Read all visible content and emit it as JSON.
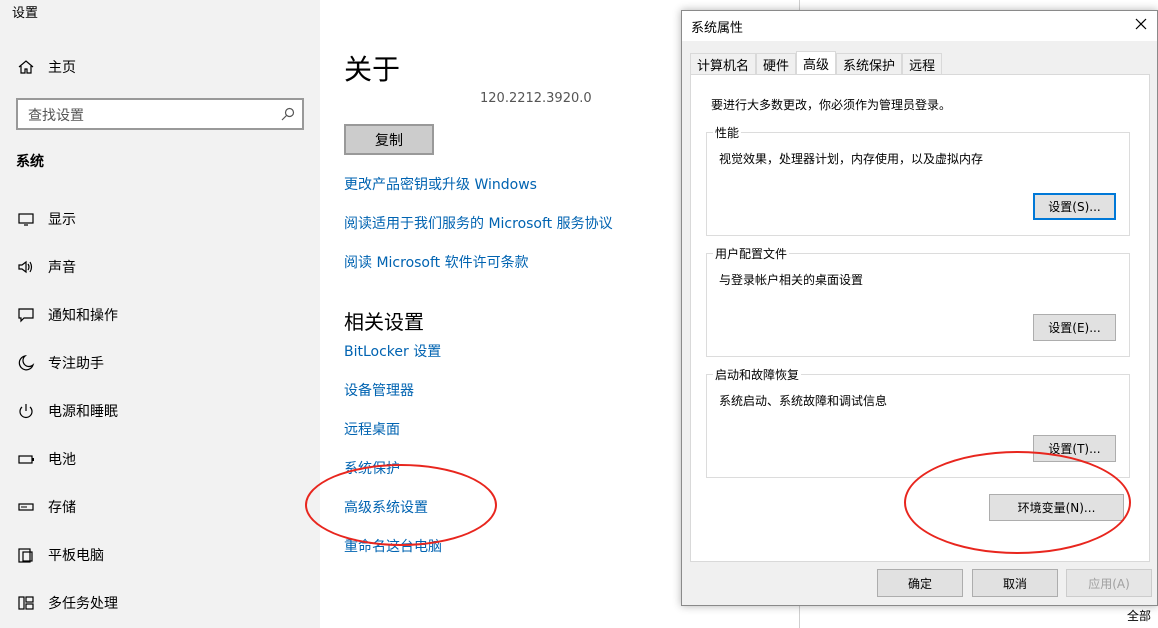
{
  "settings": {
    "app_title": "设置",
    "home": "主页",
    "search_placeholder": "查找设置",
    "section": "系统",
    "nav": [
      {
        "label": "显示",
        "icon": "display-icon"
      },
      {
        "label": "声音",
        "icon": "sound-icon"
      },
      {
        "label": "通知和操作",
        "icon": "notification-icon"
      },
      {
        "label": "专注助手",
        "icon": "moon-icon"
      },
      {
        "label": "电源和睡眠",
        "icon": "power-icon"
      },
      {
        "label": "电池",
        "icon": "battery-icon"
      },
      {
        "label": "存储",
        "icon": "storage-icon"
      },
      {
        "label": "平板电脑",
        "icon": "tablet-icon"
      },
      {
        "label": "多任务处理",
        "icon": "multitask-icon"
      }
    ],
    "content": {
      "title": "关于",
      "version": "120.2212.3920.0",
      "copy_button": "复制",
      "links": [
        "更改产品密钥或升级 Windows",
        "阅读适用于我们服务的 Microsoft 服务协议",
        "阅读 Microsoft 软件许可条款"
      ],
      "related_title": "相关设置",
      "related_links": [
        "BitLocker 设置",
        "设备管理器",
        "远程桌面",
        "系统保护",
        "高级系统设置",
        "重命名这台电脑"
      ]
    }
  },
  "dialog": {
    "title": "系统属性",
    "tabs": [
      "计算机名",
      "硬件",
      "高级",
      "系统保护",
      "远程"
    ],
    "active_tab": "高级",
    "notice": "要进行大多数更改，你必须作为管理员登录。",
    "groups": [
      {
        "title": "性能",
        "desc": "视觉效果，处理器计划，内存使用，以及虚拟内存",
        "button": "设置(S)..."
      },
      {
        "title": "用户配置文件",
        "desc": "与登录帐户相关的桌面设置",
        "button": "设置(E)..."
      },
      {
        "title": "启动和故障恢复",
        "desc": "系统启动、系统故障和调试信息",
        "button": "设置(T)..."
      }
    ],
    "env_button": "环境变量(N)...",
    "ok": "确定",
    "cancel": "取消",
    "apply": "应用(A)"
  },
  "background": {
    "partial_text": "全部"
  },
  "colors": {
    "link": "#0063b1",
    "annotation": "#e8261e",
    "focus": "#0078d7"
  }
}
